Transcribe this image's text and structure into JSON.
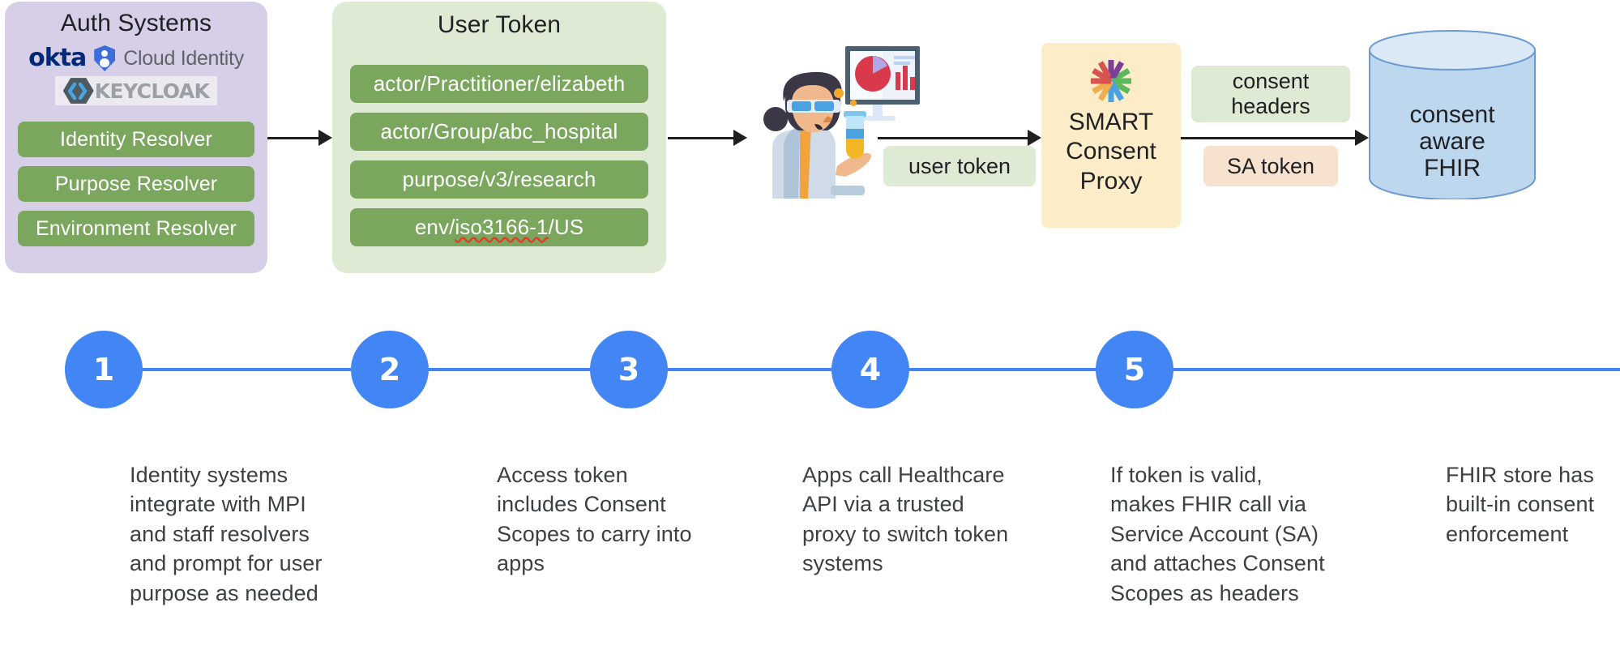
{
  "auth_systems": {
    "title": "Auth Systems",
    "logos": [
      {
        "name": "okta",
        "label": "okta"
      },
      {
        "name": "google-cloud-identity",
        "label": "Cloud Identity"
      },
      {
        "name": "keycloak",
        "label": "KEYCLOAK"
      }
    ],
    "resolvers": [
      "Identity Resolver",
      "Purpose Resolver",
      "Environment Resolver"
    ],
    "panel_color": "#d7cfe8",
    "pill_color": "#7aa75d"
  },
  "user_token": {
    "title": "User Token",
    "scopes": [
      {
        "text": "actor/Practitioner/elizabeth",
        "misspelled": ""
      },
      {
        "text": "actor/Group/abc_hospital",
        "misspelled": ""
      },
      {
        "text": "purpose/v3/research",
        "misspelled": ""
      },
      {
        "text": "env/iso3166-1/US",
        "misspelled": "iso3166-1"
      }
    ],
    "panel_color": "#dfead5"
  },
  "illustration": {
    "name": "scientist-with-test-tube-and-dashboard"
  },
  "callouts": {
    "user_token": "user token",
    "consent_headers_line1": "consent",
    "consent_headers_line2": "headers",
    "sa_token": "SA token"
  },
  "smart_proxy": {
    "logo_name": "smart-health-it-logo",
    "line1": "SMART",
    "line2": "Consent",
    "line3": "Proxy",
    "box_color": "#fdecc8"
  },
  "fhir_store": {
    "line1": "consent",
    "line2": "aware",
    "line3": "FHIR",
    "fill_color": "#bdd7ee",
    "stroke_color": "#6b9bd2"
  },
  "timeline": {
    "accent_color": "#4285f4",
    "steps": [
      {
        "number": "1",
        "text": "Identity systems integrate with MPI and staff resolvers and prompt for user purpose as needed"
      },
      {
        "number": "2",
        "text": "Access token includes Consent Scopes to carry into apps"
      },
      {
        "number": "3",
        "text": "Apps call Healthcare API via a trusted proxy to switch token systems"
      },
      {
        "number": "4",
        "text": "If token is valid, makes FHIR call via Service Account (SA) and attaches Consent Scopes as headers"
      },
      {
        "number": "5",
        "text": "FHIR store has built-in consent enforcement"
      }
    ]
  }
}
